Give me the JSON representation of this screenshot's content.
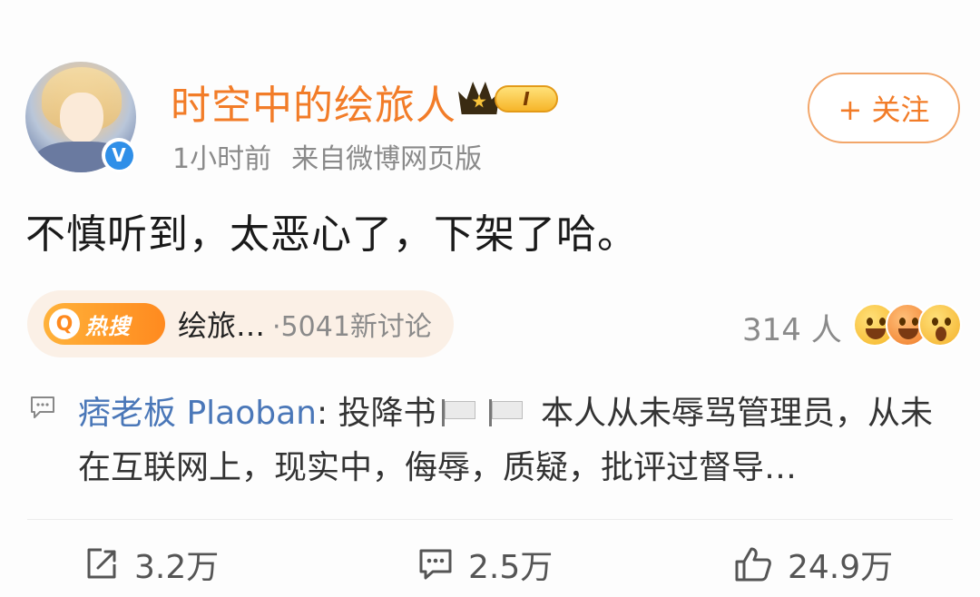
{
  "post": {
    "username": "时空中的绘旅人",
    "vip_level": "I",
    "time": "1小时前",
    "source": "来自微博网页版",
    "follow_label": "+ 关注",
    "text": "不慎听到，太恶心了，下架了哈。"
  },
  "hot_search": {
    "badge_text": "热搜",
    "topic": "绘旅…",
    "discussion_count": "·5041新讨论"
  },
  "reactions": {
    "count": "314 人"
  },
  "comment": {
    "author": "痞老板 Plaoban",
    "text_before_flags": ": 投降书",
    "text_after_flags": " 本人从未辱骂管理员，从未在互联网上，现实中，侮辱，质疑，批评过督导…"
  },
  "actions": {
    "repost_count": "3.2万",
    "comment_count": "2.5万",
    "like_count": "24.9万"
  },
  "colors": {
    "username": "#f27c28",
    "author_link": "#4a77b8",
    "verified": "#2f8fe8",
    "hot_badge": "#ff8a1f"
  }
}
